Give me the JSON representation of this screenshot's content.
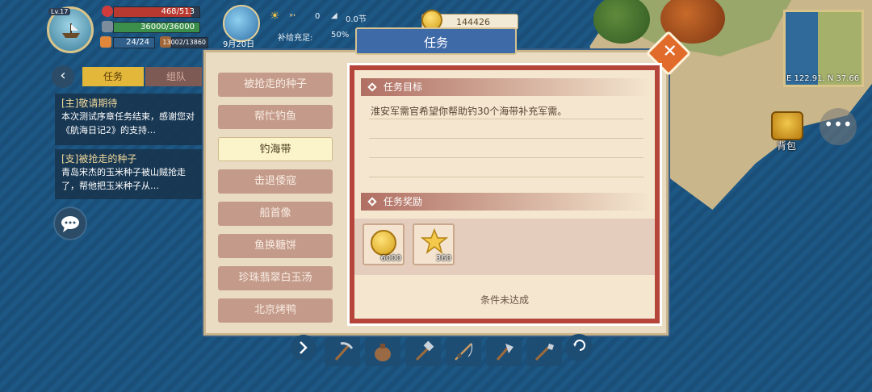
{
  "hud": {
    "level": "Lv.17",
    "hp": "468/513",
    "hp_fraction": 0.91,
    "supply": "36000/36000",
    "supply_fraction": 1.0,
    "crew": "24/24",
    "cargo": "13002/13860",
    "arrows": "0",
    "speed": "0.0节",
    "supply_status": "补给充足:",
    "supply_pct": "50%",
    "date": "9月20日",
    "gold": "144426"
  },
  "left_panel": {
    "tabs": [
      "任务",
      "组队"
    ],
    "quests": [
      {
        "title": "[主]敬请期待",
        "desc": "本次测试序章任务结束，感谢您对《航海日记2》的支持…"
      },
      {
        "title": "[支]被抢走的种子",
        "desc": "青岛宋杰的玉米种子被山贼抢走了，帮他把玉米种子从…"
      }
    ]
  },
  "dialog": {
    "title": "任务",
    "close": "✕",
    "quest_list": [
      "被抢走的种子",
      "帮忙钓鱼",
      "钓海带",
      "击退倭寇",
      "船首像",
      "鱼换糖饼",
      "珍珠翡翠白玉汤",
      "北京烤鸭"
    ],
    "selected_index": 2,
    "goal_header": "任务目标",
    "goal_text": "淮安军需官希望你帮助钓30个海带补充军需。",
    "reward_header": "任务奖励",
    "rewards": [
      {
        "icon": "gold-coin-icon",
        "amount": "6000"
      },
      {
        "icon": "star-medal-icon",
        "amount": "360"
      }
    ],
    "condition": "条件未达成"
  },
  "map": {
    "coords": "E 122.91, N 37.66",
    "bag_label": "背包",
    "more": "•••"
  },
  "colors": {
    "accent_blue": "#3f6aa8",
    "close_orange": "#e06b2a",
    "active_tab": "#e2b73a"
  }
}
